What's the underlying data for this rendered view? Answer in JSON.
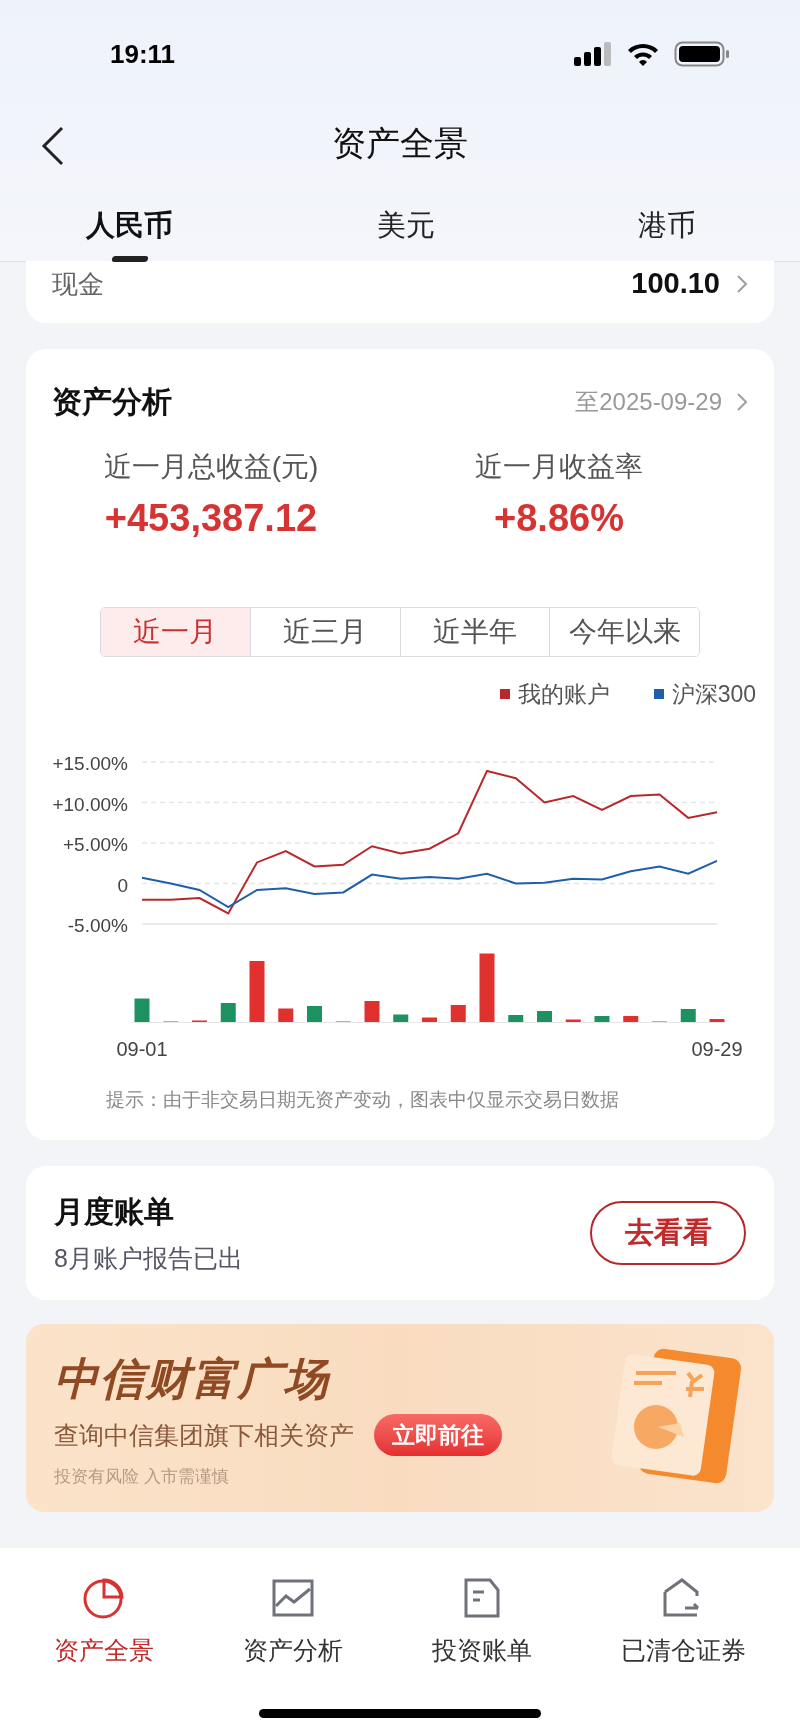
{
  "status_bar": {
    "time": "19:11"
  },
  "header": {
    "title": "资产全景"
  },
  "currency_tabs": [
    {
      "label": "人民币",
      "selected": true
    },
    {
      "label": "美元",
      "selected": false
    },
    {
      "label": "港币",
      "selected": false
    }
  ],
  "cash_row": {
    "label": "现金",
    "value": "100.10"
  },
  "analysis": {
    "title": "资产分析",
    "date": "至2025-09-29",
    "stats": [
      {
        "label": "近一月总收益(元)",
        "value": "+453,387.12"
      },
      {
        "label": "近一月收益率",
        "value": "+8.86%"
      }
    ],
    "periods": [
      {
        "label": "近一月",
        "selected": true
      },
      {
        "label": "近三月",
        "selected": false
      },
      {
        "label": "近半年",
        "selected": false
      },
      {
        "label": "今年以来",
        "selected": false
      }
    ],
    "chart_data": {
      "type": "line",
      "categories": [
        "09-01",
        null,
        null,
        null,
        null,
        null,
        null,
        null,
        null,
        null,
        null,
        null,
        null,
        null,
        null,
        null,
        null,
        null,
        null,
        null,
        "09-29"
      ],
      "yticks": [
        {
          "value": 15,
          "label": "+15.00%"
        },
        {
          "value": 10,
          "label": "+10.00%"
        },
        {
          "value": 5,
          "label": "+5.00%"
        },
        {
          "value": 0,
          "label": "0"
        },
        {
          "value": -5,
          "label": "-5.00%"
        }
      ],
      "ylim": [
        -5,
        15
      ],
      "grid": true,
      "legend": true,
      "series": [
        {
          "name": "我的账户",
          "color": "#b8282b",
          "values": [
            -2.0,
            -2.0,
            -1.8,
            -3.7,
            2.6,
            4.0,
            2.1,
            2.3,
            4.6,
            3.7,
            4.3,
            6.2,
            13.9,
            13.0,
            10.0,
            10.8,
            9.1,
            10.8,
            11.0,
            8.1,
            8.8
          ]
        },
        {
          "name": "沪深300",
          "color": "#1f5fa8",
          "values": [
            0.7,
            0.0,
            -0.8,
            -2.9,
            -0.8,
            -0.6,
            -1.3,
            -1.1,
            1.1,
            0.6,
            0.8,
            0.6,
            1.2,
            0.0,
            0.1,
            0.6,
            0.5,
            1.5,
            2.1,
            1.2,
            2.8
          ]
        }
      ]
    },
    "note": "提示：由于非交易日期无资产变动，图表中仅显示交易日数据"
  },
  "monthly_bill": {
    "title": "月度账单",
    "subtitle": "8月账户报告已出",
    "button": "去看看"
  },
  "banner": {
    "title": "中信财富广场",
    "subtitle": "查询中信集团旗下相关资产",
    "button": "立即前往",
    "disclaimer": "投资有风险 入市需谨慎"
  },
  "bottom_nav": [
    {
      "label": "资产全景",
      "selected": true
    },
    {
      "label": "资产分析",
      "selected": false
    },
    {
      "label": "投资账单",
      "selected": false
    },
    {
      "label": "已清仓证券",
      "selected": false
    }
  ]
}
